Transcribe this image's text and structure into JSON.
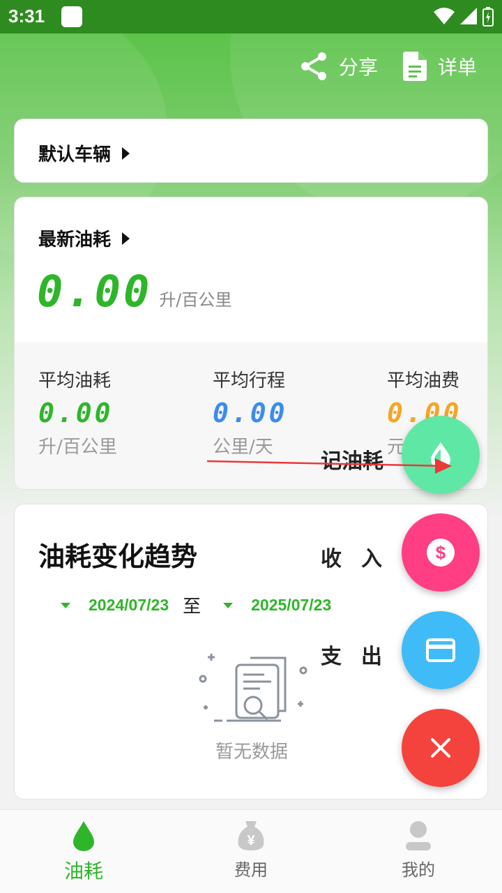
{
  "status_bar": {
    "time": "3:31"
  },
  "header": {
    "share_label": "分享",
    "detail_label": "详单"
  },
  "vehicle": {
    "label": "默认车辆"
  },
  "latest": {
    "title": "最新油耗",
    "value": "0.00",
    "unit": "升/百公里"
  },
  "stats": [
    {
      "title": "平均油耗",
      "value": "0.00",
      "unit": "升/百公里",
      "color": "#2fb52a"
    },
    {
      "title": "平均行程",
      "value": "0.00",
      "unit": "公里/天",
      "color": "#3b8cf0"
    },
    {
      "title": "平均油费",
      "value": "0.00",
      "unit": "元",
      "color": "#f5a623"
    }
  ],
  "trend": {
    "title": "油耗变化趋势",
    "start_date": "2024/07/23",
    "separator": "至",
    "end_date": "2025/07/23",
    "empty_text": "暂无数据"
  },
  "fab_menu": {
    "fuel_label": "记油耗",
    "income_label": "收入",
    "expense_label": "支出"
  },
  "bottom_nav": [
    {
      "label": "油耗",
      "active": true
    },
    {
      "label": "费用",
      "active": false
    },
    {
      "label": "我的",
      "active": false
    }
  ],
  "colors": {
    "brand_green": "#2fb52a",
    "status_bar": "#2e8b1f"
  }
}
